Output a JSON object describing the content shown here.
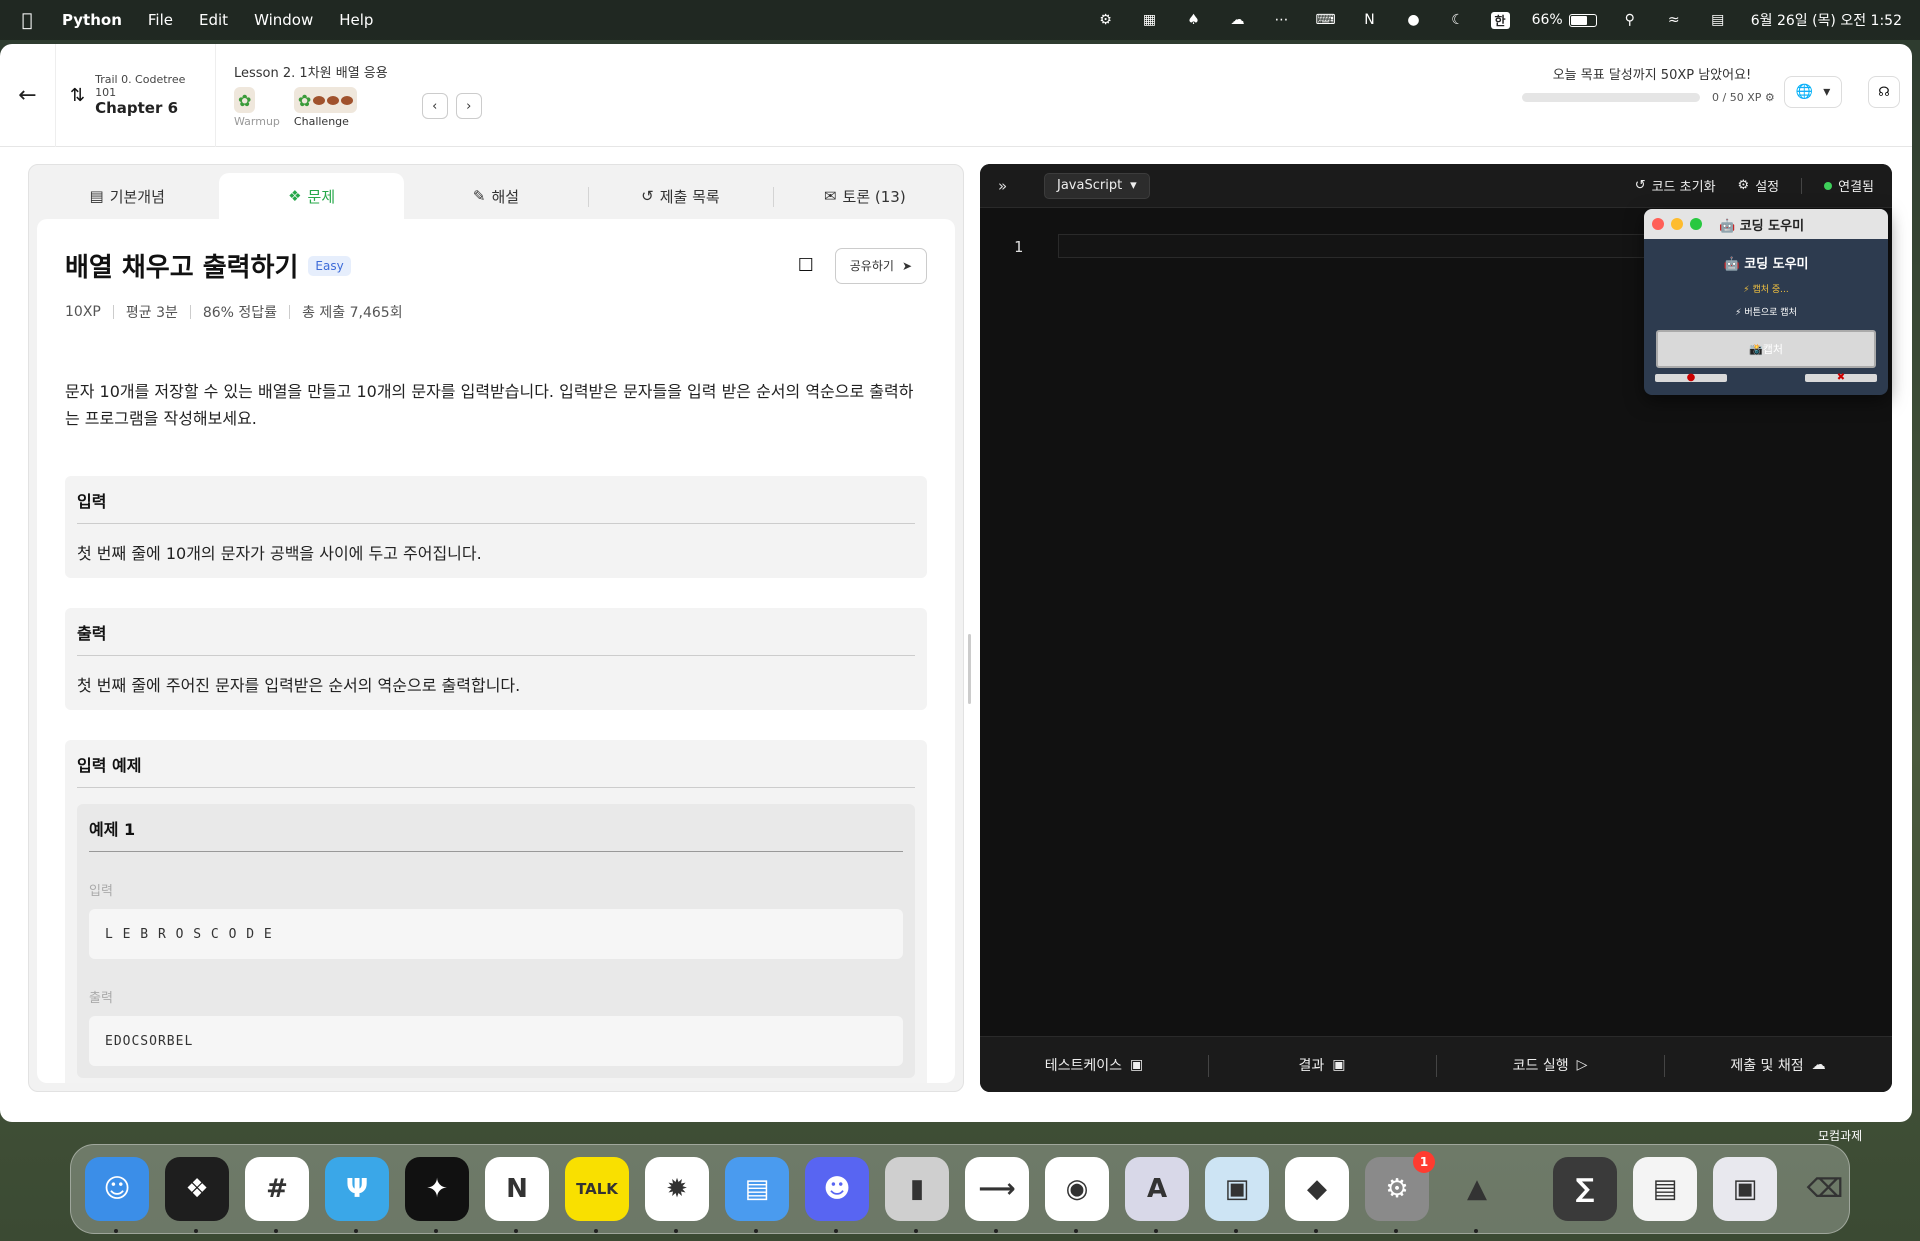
{
  "menubar": {
    "app_name": "Python",
    "menus": [
      "File",
      "Edit",
      "Window",
      "Help"
    ],
    "input_source": "한",
    "battery_percent": "66%",
    "battery_level": 0.66,
    "datetime": "6월 26일 (목) 오전 1:52"
  },
  "header": {
    "trail_label": "Trail 0. Codetree 101",
    "chapter": "Chapter 6",
    "lesson_title": "Lesson 2. 1차원 배열 응용",
    "stages": [
      {
        "label": "Warmup",
        "active": false
      },
      {
        "label": "Challenge",
        "active": true
      }
    ],
    "goal_text": "오늘 목표 달성까지 50XP 남았어요!",
    "goal_xp": "0 / 50 XP",
    "goal_progress": 0
  },
  "tabs": [
    {
      "label": "기본개념",
      "icon": "document-icon"
    },
    {
      "label": "문제",
      "icon": "puzzle-icon",
      "active": true
    },
    {
      "label": "해설",
      "icon": "edit-note-icon"
    },
    {
      "label": "제출 목록",
      "icon": "history-icon"
    },
    {
      "label": "토론 (13)",
      "icon": "chat-icon"
    }
  ],
  "problem": {
    "title": "배열 채우고 출력하기",
    "difficulty": "Easy",
    "share_label": "공유하기",
    "meta": [
      "10XP",
      "평균 3분",
      "86% 정답률",
      "총 제출 7,465회"
    ],
    "description": "문자 10개를 저장할 수 있는 배열을 만들고 10개의 문자를 입력받습니다. 입력받은 문자들을 입력 받은 순서의 역순으로 출력하는 프로그램을 작성해보세요.",
    "input_title": "입력",
    "input_body": "첫 번째 줄에 10개의 문자가 공백을 사이에 두고 주어집니다.",
    "output_title": "출력",
    "output_body": "첫 번째 줄에 주어진 문자를 입력받은 순서의 역순으로 출력합니다.",
    "examples_title": "입력 예제",
    "example": {
      "title": "예제 1",
      "input_label": "입력",
      "input": "L E B R O S C O D E",
      "output_label": "출력",
      "output": "EDOCSORBEL"
    }
  },
  "editor": {
    "language": "JavaScript",
    "reset_label": "코드 초기화",
    "settings_label": "설정",
    "status_label": "연결됨",
    "line_numbers": [
      "1"
    ],
    "bottom": [
      "테스트케이스",
      "결과",
      "코드 실행",
      "제출 및 채점"
    ]
  },
  "helper": {
    "window_title": "코딩 도우미",
    "title": "코딩 도우미",
    "status": "캡처 중...",
    "hint": "버튼으로 캡처",
    "capture_label": "캡처"
  },
  "dock": {
    "folder_label": "모컴과제",
    "settings_badge": "1",
    "apps": [
      {
        "name": "Finder",
        "icon": "finder-icon",
        "color": "#3b8ee8"
      },
      {
        "name": "Figma",
        "icon": "figma-icon",
        "color": "#1e1e1e"
      },
      {
        "name": "Slack",
        "icon": "slack-icon",
        "color": "#ffffff"
      },
      {
        "name": "Fork",
        "icon": "fork-icon",
        "color": "#3aa7e8"
      },
      {
        "name": "Perplexity",
        "icon": "sparkle-icon",
        "color": "#111111"
      },
      {
        "name": "Notion",
        "icon": "notion-icon",
        "color": "#ffffff"
      },
      {
        "name": "KakaoTalk",
        "icon": "talk-icon",
        "color": "#f9e000"
      },
      {
        "name": "ChatGPT",
        "icon": "chatgpt-icon",
        "color": "#ffffff"
      },
      {
        "name": "Hancom",
        "icon": "doc-icon",
        "color": "#4a9bef"
      },
      {
        "name": "Discord",
        "icon": "discord-icon",
        "color": "#5865f2"
      },
      {
        "name": "Parallels",
        "icon": "parallels-icon",
        "color": "#cfcfcf"
      },
      {
        "name": "VS Code",
        "icon": "vscode-icon",
        "color": "#ffffff"
      },
      {
        "name": "Chrome",
        "icon": "chrome-icon",
        "color": "#ffffff"
      },
      {
        "name": "Craft",
        "icon": "craft-icon",
        "color": "#d8d8e8"
      },
      {
        "name": "Preview",
        "icon": "preview-icon",
        "color": "#cde4f4"
      },
      {
        "name": "Jira",
        "icon": "jira-icon",
        "color": "#ffffff"
      },
      {
        "name": "System Settings",
        "icon": "gear-icon",
        "color": "#8a8a8a"
      },
      {
        "name": "Python Launcher",
        "icon": "rocket-icon",
        "color": "transparent"
      }
    ]
  }
}
